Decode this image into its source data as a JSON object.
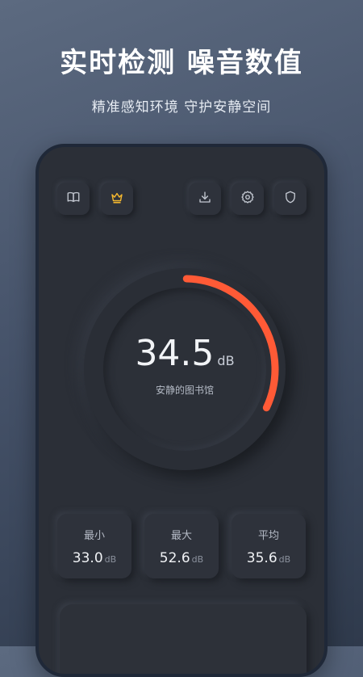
{
  "promo": {
    "title": "实时检测 噪音数值",
    "subtitle": "精准感知环境 守护安静空间"
  },
  "toolbar": {
    "left": [
      {
        "icon": "book-icon"
      },
      {
        "icon": "crown-icon",
        "color": "#f5b82e"
      }
    ],
    "right": [
      {
        "icon": "download-icon"
      },
      {
        "icon": "gear-icon"
      },
      {
        "icon": "shield-icon"
      }
    ]
  },
  "gauge": {
    "value": "34.5",
    "unit": "dB",
    "level_label": "安静的图书馆",
    "fill_fraction": 0.32,
    "accent_color": "#ff5a36"
  },
  "stats": [
    {
      "title": "最小",
      "value": "33.0",
      "unit": "dB"
    },
    {
      "title": "最大",
      "value": "52.6",
      "unit": "dB"
    },
    {
      "title": "平均",
      "value": "35.6",
      "unit": "dB"
    }
  ]
}
